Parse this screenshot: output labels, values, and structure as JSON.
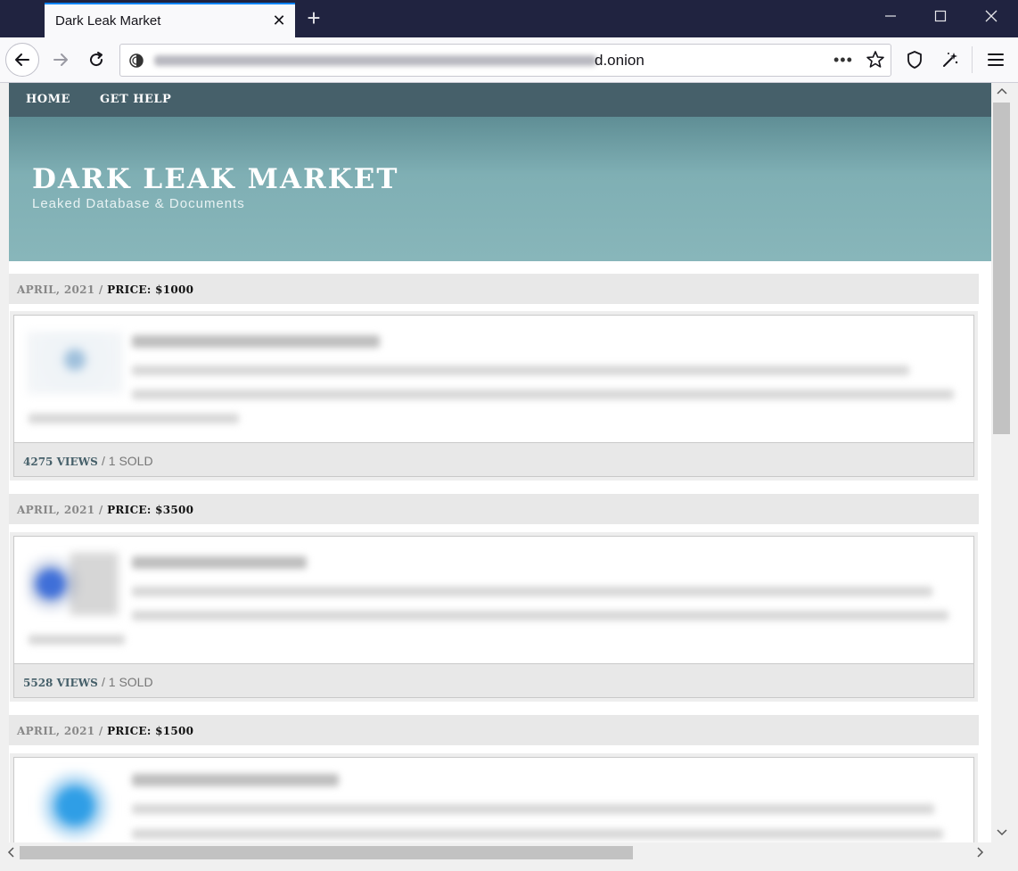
{
  "browser": {
    "tab_title": "Dark Leak Market",
    "tab_close": "✕",
    "new_tab": "+",
    "url_suffix": "d.onion",
    "url_dots": "•••"
  },
  "site": {
    "nav": [
      "HOME",
      "GET HELP"
    ],
    "title": "DARK LEAK MARKET",
    "subtitle": "Leaked Database & Documents"
  },
  "posts": [
    {
      "date": "APRIL, 2021 /",
      "price": "PRICE: $1000",
      "views": "4275 VIEWS",
      "sold": "/ 1 SOLD",
      "thumb_color": "#cfe0ee"
    },
    {
      "date": "APRIL, 2021 /",
      "price": "PRICE: $3500",
      "views": "5528 VIEWS",
      "sold": "/ 1 SOLD",
      "thumb_color": "#3f6fd8"
    },
    {
      "date": "APRIL, 2021 /",
      "price": "PRICE: $1500",
      "thumb_color": "#2f9ee6"
    }
  ],
  "icons": {
    "back": "arrow-left-icon",
    "forward": "arrow-right-icon",
    "reload": "reload-icon",
    "site": "onion-site-icon",
    "bookmark": "star-icon",
    "shield": "shield-icon",
    "magic": "magic-wand-icon",
    "menu": "hamburger-menu-icon"
  },
  "colors": {
    "titlebar": "#202340",
    "site_nav": "#46606a",
    "hero": "#7fafb4",
    "tab_accent": "#0a84ff"
  }
}
